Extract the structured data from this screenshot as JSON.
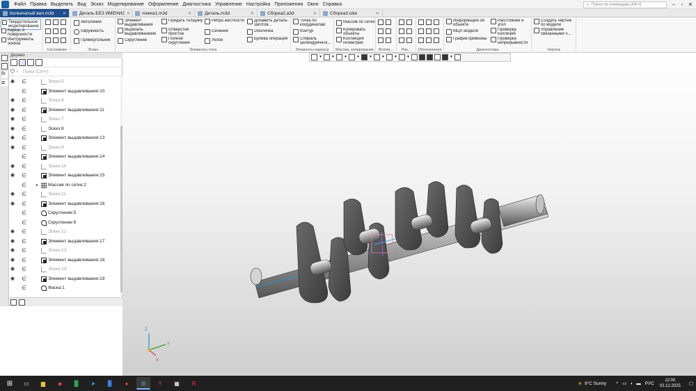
{
  "menu": [
    "Файл",
    "Правка",
    "Выделить",
    "Вид",
    "Эскиз",
    "Моделирование",
    "Оформление",
    "Диагностика",
    "Управление",
    "Настройка",
    "Приложения",
    "Окно",
    "Справка"
  ],
  "command_search": {
    "placeholder": "Поиск по командам (Alt+/)"
  },
  "tabs": [
    {
      "label": "Коленчатый вал.m3d",
      "active": true
    },
    {
      "label": "Деталь БЕЗ ИМЕНИ2",
      "active": false
    },
    {
      "label": "ложка1.m3d",
      "active": false
    },
    {
      "label": "Деталь.m3d",
      "active": false
    },
    {
      "label": "Сборка2.a3d",
      "active": false
    },
    {
      "label": "Сборка3.cdw",
      "active": false
    }
  ],
  "ribbon": {
    "modes": [
      "Твердотельное моделирование",
      "Каркас и поверхности",
      "Инструменты эскиза"
    ],
    "groups": {
      "system": "Системная",
      "sketch": "Эскиз",
      "body": "Элементы тела",
      "frame": "Элементы каркаса",
      "array": "Массив, копирование",
      "aux": "Вспом...",
      "dim": "Раз...",
      "notation": "Обозначения",
      "diag": "Диагностика",
      "drawing": "Чертеж"
    },
    "sketch_cmds": [
      "Автолиния",
      "Окружность",
      "Прямоугольник"
    ],
    "body_cmds": [
      "Элемент выдавливания",
      "Вырезать выдавливанием",
      "Скругление",
      "Придать толщину",
      "Отверстие простое",
      "Полное скругление",
      "Ребро жесткости",
      "Сечение",
      "Уклон",
      "Добавить деталь-заготов...",
      "Оболочка",
      "Булева операция"
    ],
    "frame_cmds": [
      "Точка по координатам",
      "Контур",
      "Спираль цилиндрическ..."
    ],
    "array_cmds": [
      "Массив по сетке",
      "Копировать объекты",
      "Коллекция геометрии"
    ],
    "diag_cmds": [
      "Информация об объекте",
      "МЦХ модели",
      "График кривизны",
      "Расстояние и угол",
      "Проверка коллизий",
      "Проверка непрерывности"
    ],
    "drawing_cmds": [
      "Создать чертеж по модели",
      "Управление связанными ч..."
    ]
  },
  "tree": {
    "title": "Дерево",
    "search_placeholder": "Поиск (Ctrl+/)",
    "items": [
      {
        "label": "Эскиз:5",
        "type": "sketch",
        "eye": true,
        "dim": true
      },
      {
        "label": "Элемент выдавливания:10",
        "type": "ext",
        "eye": false,
        "dim": false
      },
      {
        "label": "Эскиз:6",
        "type": "sketch",
        "eye": true,
        "dim": true
      },
      {
        "label": "Элемент выдавливания:11",
        "type": "ext",
        "eye": true,
        "dim": false
      },
      {
        "label": "Эскиз:7",
        "type": "sketch",
        "eye": true,
        "dim": true
      },
      {
        "label": "Эскиз:8",
        "type": "sketch",
        "eye": true,
        "dim": false
      },
      {
        "label": "Элемент выдавливания:13",
        "type": "ext",
        "eye": true,
        "dim": false
      },
      {
        "label": "Эскиз:9",
        "type": "sketch",
        "eye": true,
        "dim": true
      },
      {
        "label": "Элемент выдавливания:14",
        "type": "ext",
        "eye": false,
        "dim": false
      },
      {
        "label": "Эскиз:10",
        "type": "sketch",
        "eye": true,
        "dim": true
      },
      {
        "label": "Элемент выдавливания:15",
        "type": "ext",
        "eye": true,
        "dim": false
      },
      {
        "label": "Массив по сетке:2",
        "type": "grid",
        "eye": false,
        "dim": false,
        "expander": true
      },
      {
        "label": "Эскиз:11",
        "type": "sketch",
        "eye": true,
        "dim": true
      },
      {
        "label": "Элемент выдавливания:16",
        "type": "ext",
        "eye": true,
        "dim": false
      },
      {
        "label": "Скругление:5",
        "type": "round",
        "eye": false,
        "dim": false
      },
      {
        "label": "Скругление:6",
        "type": "round",
        "eye": false,
        "dim": false
      },
      {
        "label": "Эскиз:12",
        "type": "sketch",
        "eye": true,
        "dim": true
      },
      {
        "label": "Элемент выдавливания:17",
        "type": "ext",
        "eye": true,
        "dim": false
      },
      {
        "label": "Эскиз:13",
        "type": "sketch",
        "eye": true,
        "dim": true
      },
      {
        "label": "Элемент выдавливания:18",
        "type": "ext",
        "eye": true,
        "dim": false
      },
      {
        "label": "Эскиз:14",
        "type": "sketch",
        "eye": true,
        "dim": true
      },
      {
        "label": "Элемент выдавливания:19",
        "type": "ext",
        "eye": true,
        "dim": false
      },
      {
        "label": "Фаска:1",
        "type": "round",
        "eye": false,
        "dim": false
      }
    ]
  },
  "axes": {
    "x": "X",
    "y": "Y",
    "z": "Z"
  },
  "tray": {
    "weather": "9°C  Sunny",
    "lang": "РУС",
    "time": "12:00",
    "date": "02.12.2025"
  },
  "colors": {
    "accent": "#1f4e8c",
    "taskbar": "#202020",
    "selection": "#7aa1d2"
  }
}
